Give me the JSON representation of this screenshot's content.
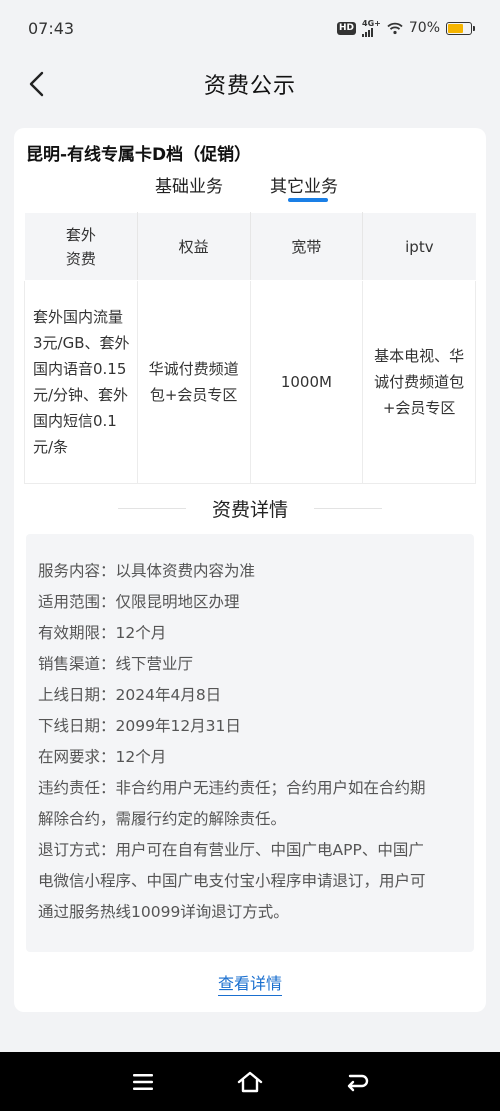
{
  "status_bar": {
    "time": "07:43",
    "hd": "HD",
    "network": "4G+",
    "battery": "70%",
    "battery_level": 0.7,
    "battery_color": "#f5b400"
  },
  "header": {
    "title": "资费公示",
    "back_icon": "chevron-left-icon"
  },
  "plan": {
    "name": "昆明-有线专属卡D档（促销）"
  },
  "tabs": [
    {
      "label": "基础业务",
      "active": false
    },
    {
      "label": "其它业务",
      "active": true
    }
  ],
  "accent_color": "#1a7fe6",
  "table": {
    "headers": [
      "套外\n资费",
      "权益",
      "宽带",
      "iptv"
    ],
    "rows": [
      [
        "套外国内流量3元/GB、套外国内语音0.15元/分钟、套外国内短信0.1元/条",
        "华诚付费频道包+会员专区",
        "1000M",
        "基本电视、华诚付费频道包+会员专区"
      ]
    ]
  },
  "details": {
    "section_title": "资费详情",
    "items": [
      {
        "key": "服务内容：",
        "value": "以具体资费内容为准"
      },
      {
        "key": "适用范围：",
        "value": "仅限昆明地区办理"
      },
      {
        "key": "有效期限：",
        "value": "12个月"
      },
      {
        "key": "销售渠道：",
        "value": "线下营业厅"
      },
      {
        "key": "上线日期：",
        "value": "2024年4月8日"
      },
      {
        "key": "下线日期：",
        "value": "2099年12月31日"
      },
      {
        "key": "在网要求：",
        "value": "12个月"
      },
      {
        "key": "违约责任：",
        "value": "非合约用户无违约责任；合约用户如在合约期"
      },
      {
        "key": "",
        "value": "解除合约，需履行约定的解除责任。"
      },
      {
        "key": "退订方式：",
        "value": "用户可在自有营业厅、中国广电APP、中国广"
      },
      {
        "key": "",
        "value": "电微信小程序、中国广电支付宝小程序申请退订，用户可"
      },
      {
        "key": "",
        "value": "通过服务热线10099详询退订方式。"
      }
    ],
    "view_details_label": "查看详情"
  },
  "bottom_nav": {
    "menu_icon": "menu-icon",
    "home_icon": "home-icon",
    "back_icon": "back-icon"
  }
}
